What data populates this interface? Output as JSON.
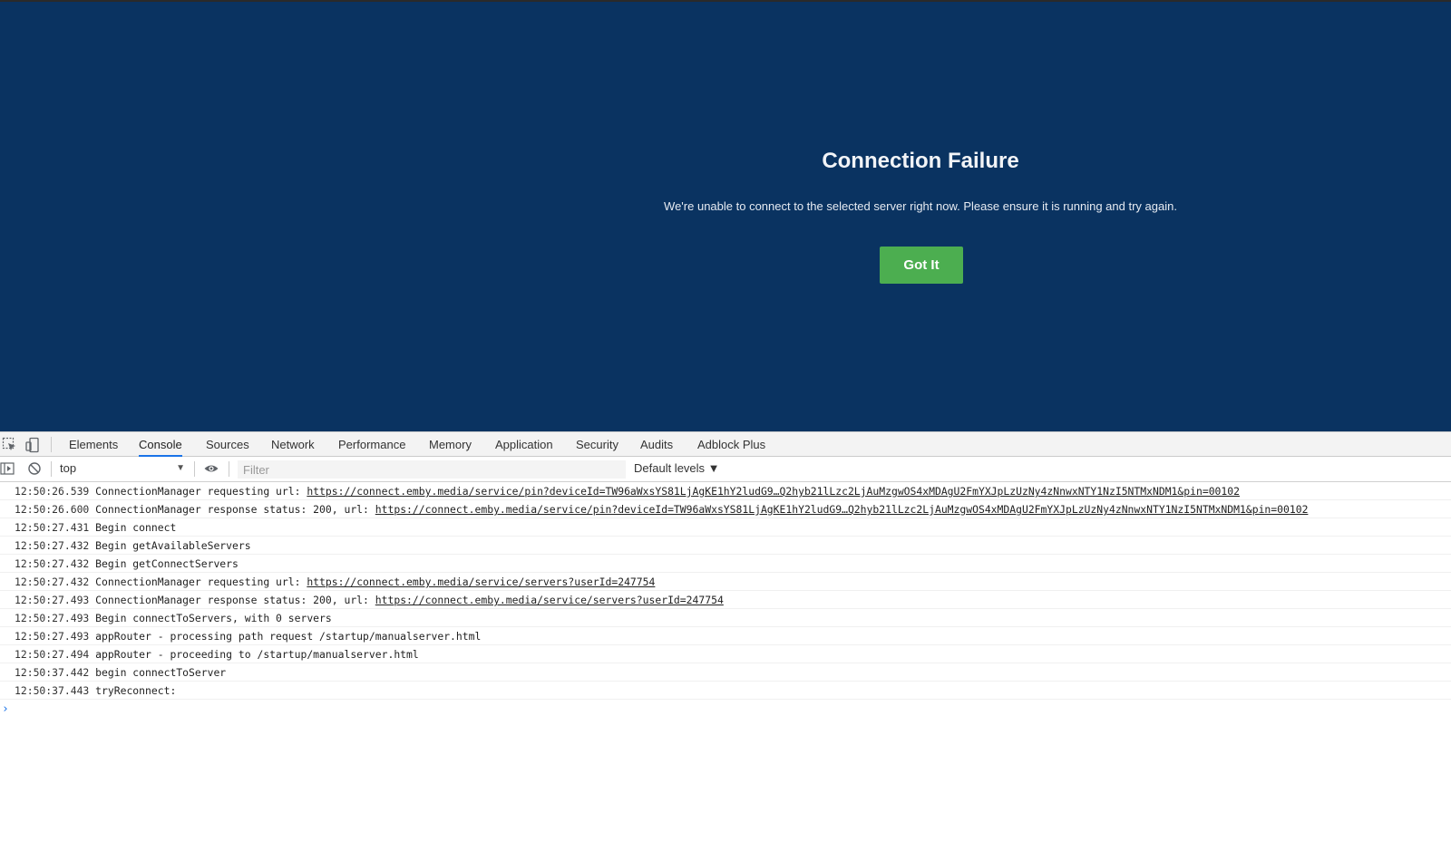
{
  "dialog": {
    "title": "Connection Failure",
    "message": "We're unable to connect to the selected server right now. Please ensure it is running and try again.",
    "button_label": "Got It"
  },
  "devtools": {
    "tabs": [
      {
        "label": "Elements",
        "active": false
      },
      {
        "label": "Console",
        "active": true
      },
      {
        "label": "Sources",
        "active": false
      },
      {
        "label": "Network",
        "active": false
      },
      {
        "label": "Performance",
        "active": false
      },
      {
        "label": "Memory",
        "active": false
      },
      {
        "label": "Application",
        "active": false
      },
      {
        "label": "Security",
        "active": false
      },
      {
        "label": "Audits",
        "active": false
      },
      {
        "label": "Adblock Plus",
        "active": false
      }
    ],
    "toolbar": {
      "context": "top",
      "filter_placeholder": "Filter",
      "levels": "Default levels ▼"
    },
    "console": {
      "entries": [
        {
          "time": "12:50:26.539",
          "text": "ConnectionManager requesting url: ",
          "link": "https://connect.emby.media/service/pin?deviceId=TW96aWxsYS81LjAgKE1hY2ludG9…Q2hyb21lLzc2LjAuMzgwOS4xMDAgU2FmYXJpLzUzNy4zNnwxNTY1NzI5NTMxNDM1&pin=00102"
        },
        {
          "time": "12:50:26.600",
          "text": "ConnectionManager response status: 200, url: ",
          "link": "https://connect.emby.media/service/pin?deviceId=TW96aWxsYS81LjAgKE1hY2ludG9…Q2hyb21lLzc2LjAuMzgwOS4xMDAgU2FmYXJpLzUzNy4zNnwxNTY1NzI5NTMxNDM1&pin=00102"
        },
        {
          "time": "12:50:27.431",
          "text": "Begin connect",
          "link": ""
        },
        {
          "time": "12:50:27.432",
          "text": "Begin getAvailableServers",
          "link": ""
        },
        {
          "time": "12:50:27.432",
          "text": "Begin getConnectServers",
          "link": ""
        },
        {
          "time": "12:50:27.432",
          "text": "ConnectionManager requesting url: ",
          "link": "https://connect.emby.media/service/servers?userId=247754"
        },
        {
          "time": "12:50:27.493",
          "text": "ConnectionManager response status: 200, url: ",
          "link": "https://connect.emby.media/service/servers?userId=247754"
        },
        {
          "time": "12:50:27.493",
          "text": "Begin connectToServers, with 0 servers",
          "link": ""
        },
        {
          "time": "12:50:27.493",
          "text": "appRouter - processing path request /startup/manualserver.html",
          "link": ""
        },
        {
          "time": "12:50:27.494",
          "text": "appRouter - proceeding to /startup/manualserver.html",
          "link": ""
        },
        {
          "time": "12:50:37.442",
          "text": "begin connectToServer",
          "link": ""
        },
        {
          "time": "12:50:37.443",
          "text": "tryReconnect:",
          "link": ""
        }
      ],
      "prompt": "›"
    }
  }
}
